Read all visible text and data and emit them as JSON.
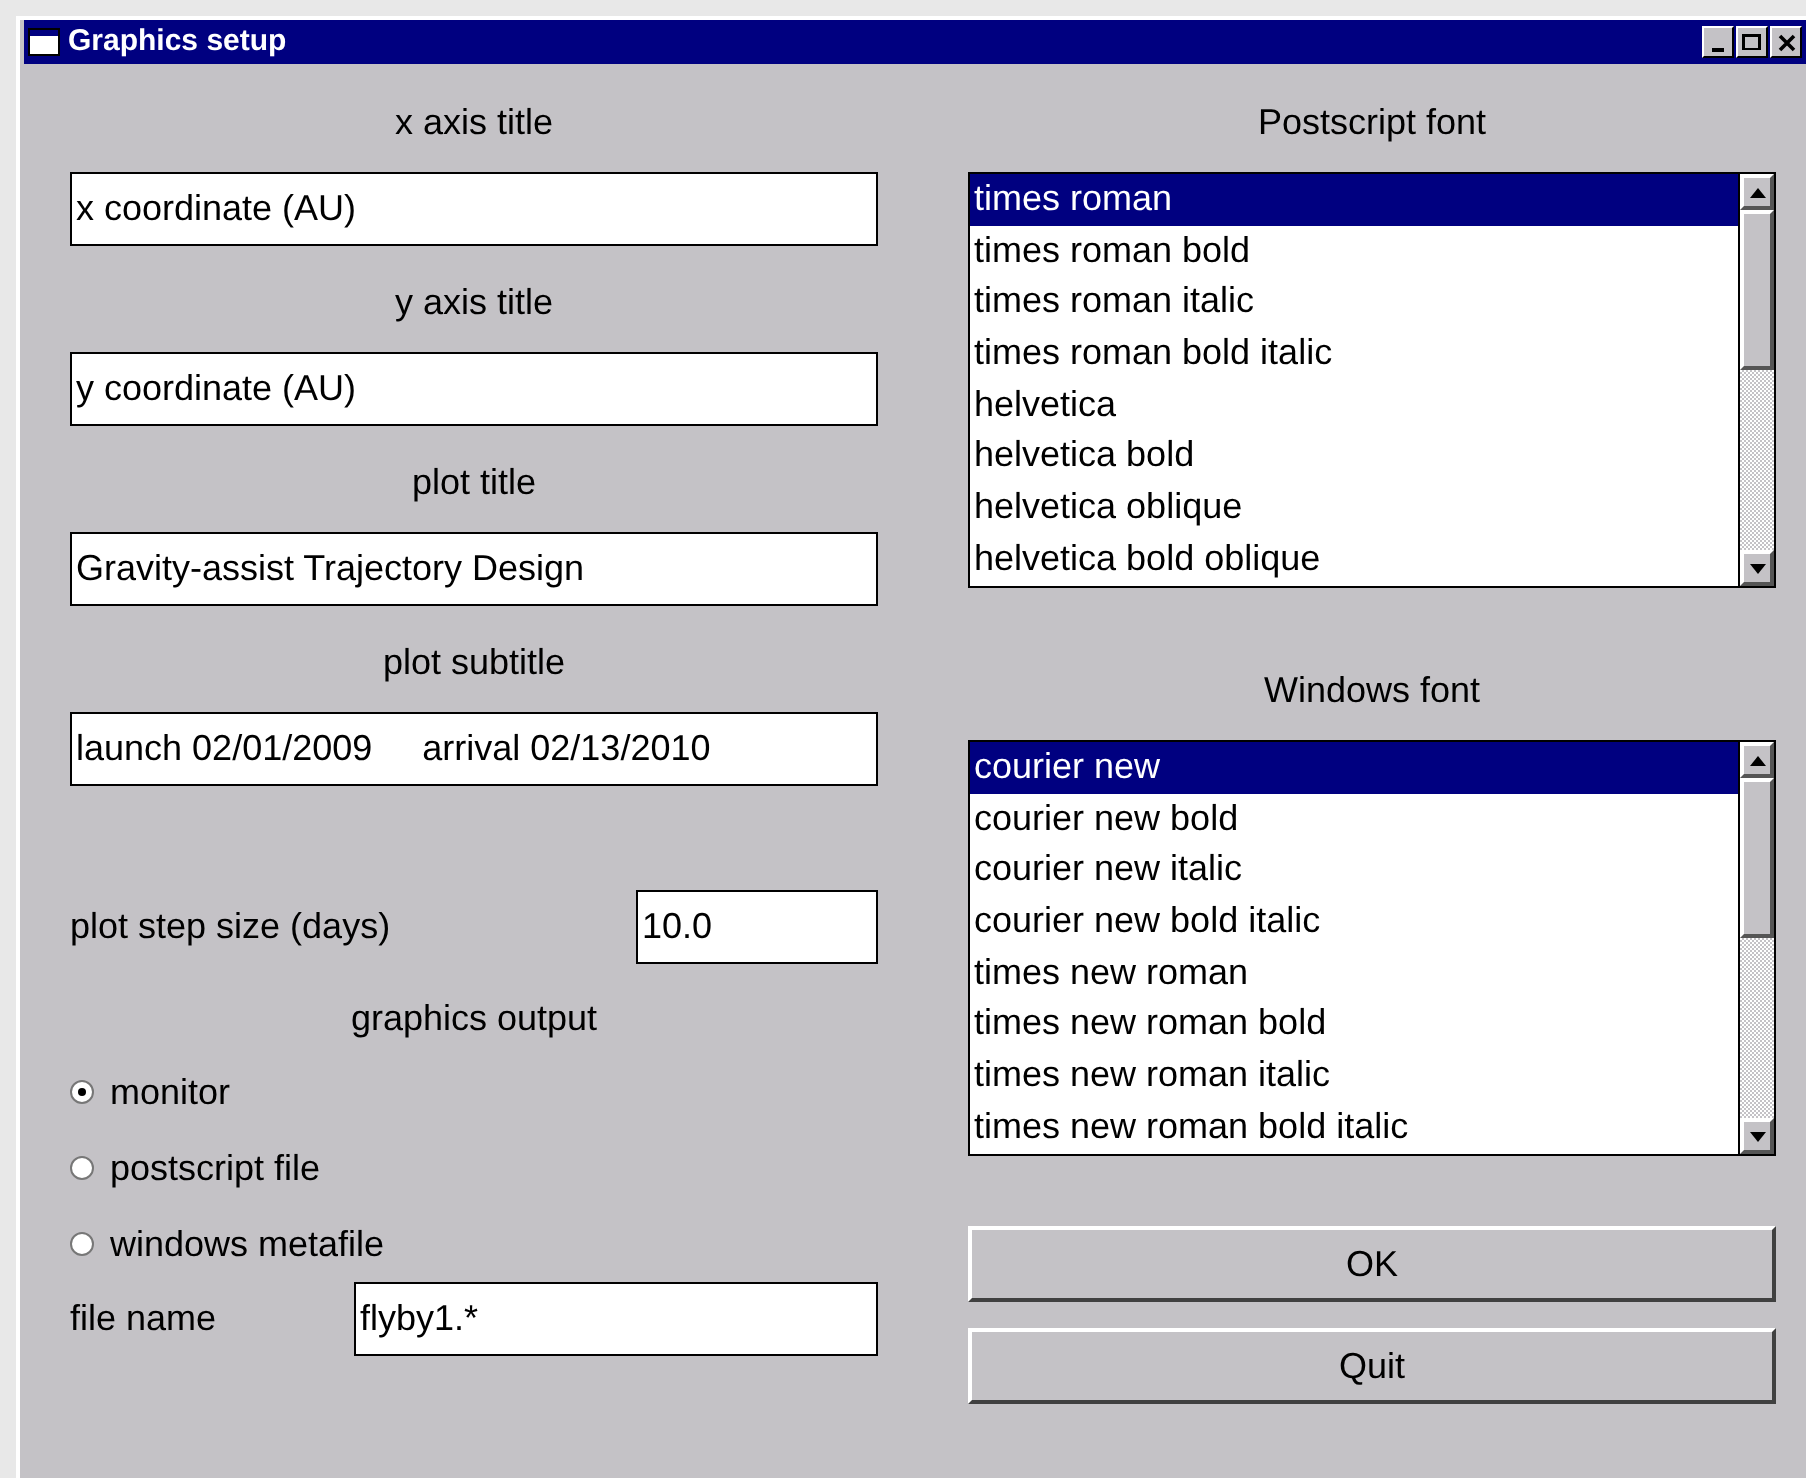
{
  "window": {
    "title": "Graphics setup"
  },
  "fields": [
    {
      "label": "x axis title",
      "value": "x coordinate (AU)"
    },
    {
      "label": "y axis title",
      "value": "y coordinate (AU)"
    },
    {
      "label": "plot title",
      "value": "Gravity-assist Trajectory Design"
    },
    {
      "label": "plot subtitle",
      "value": "launch 02/01/2009     arrival 02/13/2010"
    }
  ],
  "step_size": {
    "label": "plot step size (days)",
    "value": "10.0"
  },
  "graphics_output": {
    "label": "graphics output",
    "options": [
      {
        "label": "monitor",
        "selected": true
      },
      {
        "label": "postscript file",
        "selected": false
      },
      {
        "label": "windows metafile",
        "selected": false
      }
    ]
  },
  "file_name": {
    "label": "file name",
    "value": "flyby1.*"
  },
  "lists": [
    {
      "label": "Postscript font",
      "items": [
        {
          "label": "times roman",
          "selected": true
        },
        {
          "label": "times roman bold",
          "selected": false
        },
        {
          "label": "times roman italic",
          "selected": false
        },
        {
          "label": "times roman bold italic",
          "selected": false
        },
        {
          "label": "helvetica",
          "selected": false
        },
        {
          "label": "helvetica bold",
          "selected": false
        },
        {
          "label": "helvetica oblique",
          "selected": false
        },
        {
          "label": "helvetica bold oblique",
          "selected": false
        }
      ]
    },
    {
      "label": "Windows font",
      "items": [
        {
          "label": "courier new",
          "selected": true
        },
        {
          "label": "courier new bold",
          "selected": false
        },
        {
          "label": "courier new italic",
          "selected": false
        },
        {
          "label": "courier new bold italic",
          "selected": false
        },
        {
          "label": "times new roman",
          "selected": false
        },
        {
          "label": "times new roman bold",
          "selected": false
        },
        {
          "label": "times new roman italic",
          "selected": false
        },
        {
          "label": "times new roman bold italic",
          "selected": false
        }
      ]
    }
  ],
  "buttons": [
    "OK",
    "Quit"
  ]
}
